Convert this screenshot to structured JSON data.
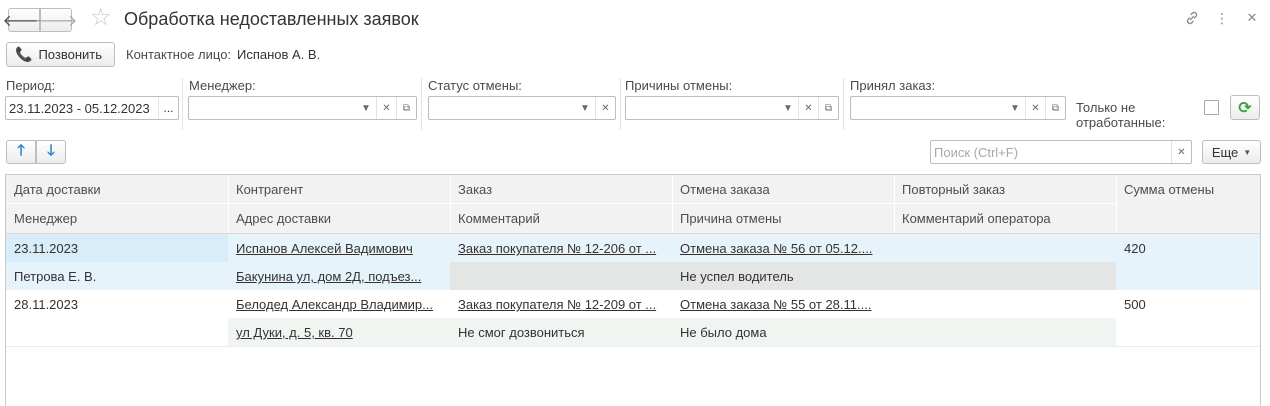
{
  "window": {
    "title": "Обработка недоставленных заявок",
    "icons": [
      "back-arrow-icon",
      "forward-arrow-icon",
      "star-icon",
      "link-icon",
      "more-vertical-icon",
      "close-icon"
    ]
  },
  "call": {
    "button_label": "Позвонить",
    "contact_label": "Контактное лицо:",
    "contact_value": "Испанов А. В."
  },
  "filters": {
    "period": {
      "label": "Период:",
      "value": "23.11.2023 - 05.12.2023",
      "button": "..."
    },
    "manager": {
      "label": "Менеджер:",
      "value": ""
    },
    "cancel_status": {
      "label": "Статус отмены:",
      "value": ""
    },
    "cancel_reasons": {
      "label": "Причины отмены:",
      "value": ""
    },
    "accepted_by": {
      "label": "Принял заказ:",
      "value": ""
    },
    "only_unprocessed": {
      "label": "Только не отработанные:",
      "checked": false
    }
  },
  "toolbar": {
    "search_placeholder": "Поиск (Ctrl+F)",
    "more_label": "Еще"
  },
  "table": {
    "headers": {
      "row1": [
        "Дата доставки",
        "Контрагент",
        "Заказ",
        "Отмена заказа",
        "Повторный заказ",
        "Сумма отмены"
      ],
      "row2": [
        "Менеджер",
        "Адрес доставки",
        "Комментарий",
        "Причина отмены",
        "Комментарий оператора"
      ]
    },
    "rows": [
      {
        "date": "23.11.2023",
        "counterparty": "Испанов Алексей Вадимович",
        "order": "Заказ покупателя № 12-206 от ...",
        "cancel_order": "Отмена заказа № 56 от 05.12....",
        "repeat_order": "",
        "amount": "420",
        "manager": "Петрова Е. В.",
        "address": "Бакунина ул,  дом 2Д,  подъез...",
        "comment": "",
        "cancel_reason": "Не успел водитель",
        "operator_comment": ""
      },
      {
        "date": "28.11.2023",
        "counterparty": " Белодед Александр Владимир...",
        "order": "Заказ покупателя № 12-209 от ...",
        "cancel_order": "Отмена заказа № 55 от 28.11....",
        "repeat_order": "",
        "amount": "500",
        "manager": "",
        "address": "ул Дуки,  д. 5,  кв. 70",
        "comment": "Не смог дозвониться",
        "cancel_reason": "Не было дома",
        "operator_comment": ""
      }
    ]
  },
  "colors": {
    "selected_row": "#d8edf9",
    "selected_row_light": "#e6f3fb",
    "refresh_icon": "#3aa33a",
    "arrow_icon": "#2e7dd1",
    "phone_icon": "#d1601b"
  }
}
